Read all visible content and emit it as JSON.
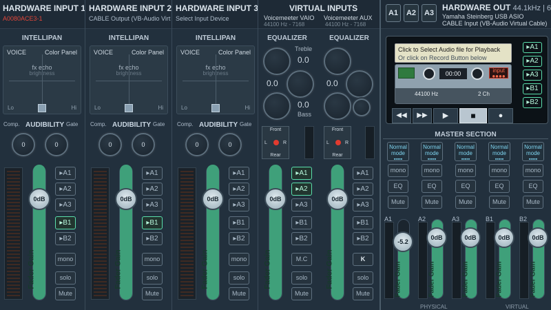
{
  "header": {
    "hw_inputs": [
      {
        "title": "HARDWARE INPUT",
        "num": "1",
        "device": "A0080ACE3-1"
      },
      {
        "title": "HARDWARE INPUT",
        "num": "2",
        "device": "CABLE Output (VB-Audio Virt"
      },
      {
        "title": "HARDWARE INPUT",
        "num": "3",
        "device": "Select Input Device"
      }
    ],
    "virtual_inputs_title": "VIRTUAL INPUTS",
    "virtual_inputs": [
      {
        "name": "Voicemeeter VAIO",
        "info": "44100 Hz - 7168"
      },
      {
        "name": "Voicemeeter AUX",
        "info": "44100 Hz - 7168"
      }
    ],
    "out_buttons": [
      "A1",
      "A2",
      "A3"
    ],
    "hw_out_title": "HARDWARE OUT",
    "hw_out_rate": "44.1kHz | 64",
    "hw_out_dev1": "Yamaha Steinberg USB ASIO",
    "hw_out_dev2": "CABLE Input (VB-Audio Virtual Cable)"
  },
  "strips": {
    "intellipan": "INTELLIPAN",
    "voice": "VOICE",
    "color_panel": "Color Panel",
    "fx_echo": "fx echo",
    "brightness": "brightness",
    "lo": "Lo",
    "hi": "Hi",
    "comp": "Comp.",
    "audibility": "AUDIBILITY",
    "gate": "Gate",
    "knob0": "0",
    "fader_db": "0dB",
    "fader_label": "Fader Gain",
    "buses": [
      "A1",
      "A2",
      "A3",
      "B1",
      "B2"
    ],
    "mono": "mono",
    "solo": "solo",
    "mute": "Mute",
    "mc": "M.C",
    "k": "K"
  },
  "equalizer": {
    "title": "EQUALIZER",
    "treble": "Treble",
    "bass": "Bass",
    "val": "0.0",
    "front": "Front",
    "rear": "Rear",
    "l": "L",
    "r": "R"
  },
  "recorder": {
    "tip1": "Click to Select Audio file for Playback",
    "tip2": "Or click on Record Button below",
    "time": "00:00",
    "input": "input",
    "rate": "44100 Hz",
    "ch": "2 Ch",
    "side_buttons": [
      "A1",
      "A2",
      "A3",
      "B1",
      "B2"
    ]
  },
  "master": {
    "title": "MASTER SECTION",
    "mode": "Normal mode",
    "mode_dots": "▪▪▪▪▪",
    "mono": "mono",
    "eq": "EQ",
    "mute": "Mute",
    "buses": [
      "A1",
      "A2",
      "A3",
      "B1",
      "B2"
    ],
    "a1_db": "-5.2",
    "db0": "0dB",
    "physical": "PHYSICAL",
    "virtual": "VIRTUAL"
  }
}
